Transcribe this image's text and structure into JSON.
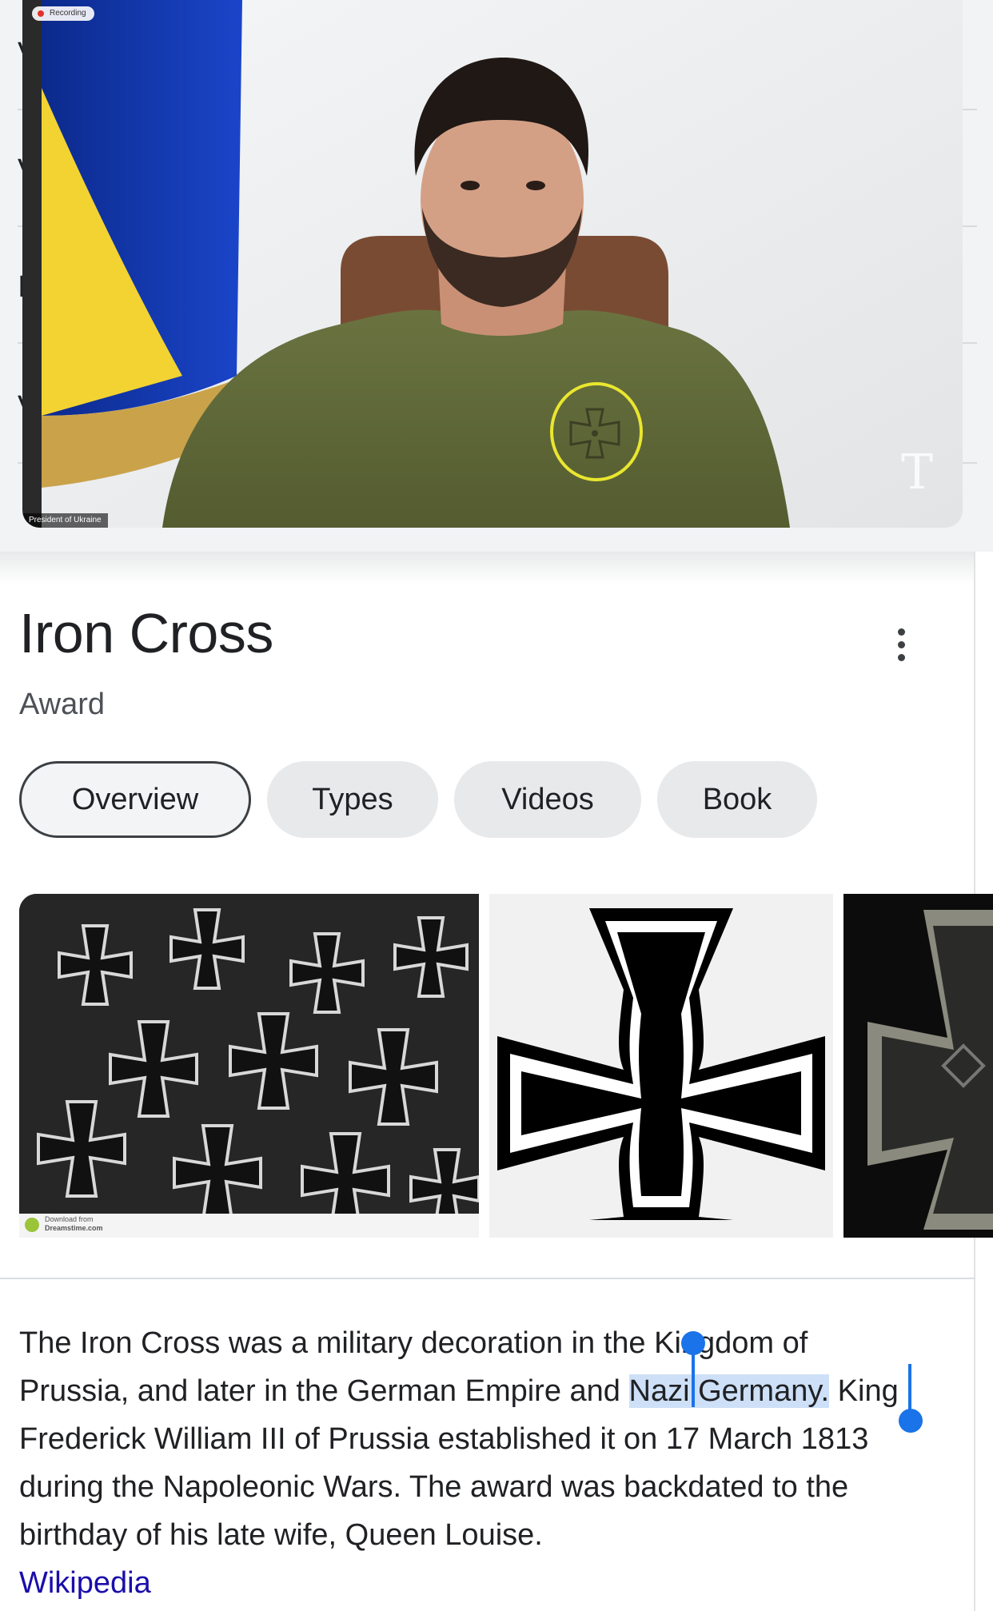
{
  "video": {
    "recording_label": "Recording",
    "speaker_label": "President of Ukraine",
    "publisher_logo": "nyt-t-logo",
    "background_row_letters": [
      "V",
      "V",
      "I",
      "V"
    ],
    "highlight_color": "#e9e62f"
  },
  "panel": {
    "title": "Iron Cross",
    "subtitle": "Award",
    "more_icon": "kebab-icon",
    "chips": [
      {
        "label": "Overview",
        "active": true
      },
      {
        "label": "Types",
        "active": false
      },
      {
        "label": "Videos",
        "active": false
      },
      {
        "label": "Book",
        "active": false
      }
    ],
    "images": [
      {
        "name": "iron-cross-pile-photo",
        "watermark_line1": "Download from",
        "watermark_line2": "Dreamstime.com"
      },
      {
        "name": "iron-cross-symbol"
      },
      {
        "name": "iron-cross-medal-photo"
      }
    ]
  },
  "description": {
    "text_before": "The Iron Cross was a military decoration in the Kingdom of Prussia, and later in the German Empire and ",
    "selected_text": "Nazi Germany.",
    "text_after": " King Frederick William III of Prussia established it on 17 March 1813 during the Napoleonic Wars. The award was backdated to the birthday of his late wife, Queen Louise.",
    "source_link": "Wikipedia"
  },
  "colors": {
    "link": "#1a0dab",
    "selection": "#cde0f7",
    "selection_handle": "#1a73e8",
    "chip_bg": "#e8e9eb"
  }
}
